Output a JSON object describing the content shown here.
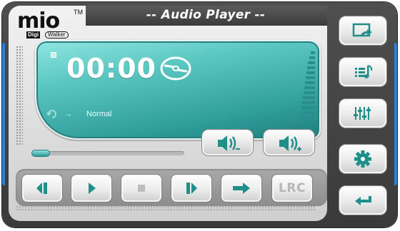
{
  "brand": {
    "logo_text": "mio",
    "trademark": "TM",
    "sub_logo_digi": "Digi",
    "sub_logo_walker": "Walker"
  },
  "header": {
    "title": "-- Audio Player --"
  },
  "display": {
    "time": "00:00",
    "play_mode": "Normal",
    "disc_icon": "disc-icon",
    "repeat_icon": "repeat-icon",
    "arrow": "→",
    "accent_color": "#4fbcb8"
  },
  "progress": {
    "value": 0.0
  },
  "volume": {
    "down_icon": "volume-down-icon",
    "up_icon": "volume-up-icon"
  },
  "controls": {
    "buttons": [
      {
        "icon": "previous-track-icon"
      },
      {
        "icon": "play-icon"
      },
      {
        "icon": "stop-icon"
      },
      {
        "icon": "next-track-icon"
      },
      {
        "icon": "forward-arrow-icon"
      },
      {
        "label": "LRC"
      }
    ]
  },
  "right_menu": {
    "buttons": [
      {
        "icon": "open-folder-icon"
      },
      {
        "icon": "playlist-icon"
      },
      {
        "icon": "equalizer-icon"
      },
      {
        "icon": "settings-gear-icon"
      },
      {
        "icon": "back-return-icon"
      }
    ]
  },
  "colors": {
    "icon_teal": "#1f8f8a",
    "frame_dark": "#444444"
  }
}
